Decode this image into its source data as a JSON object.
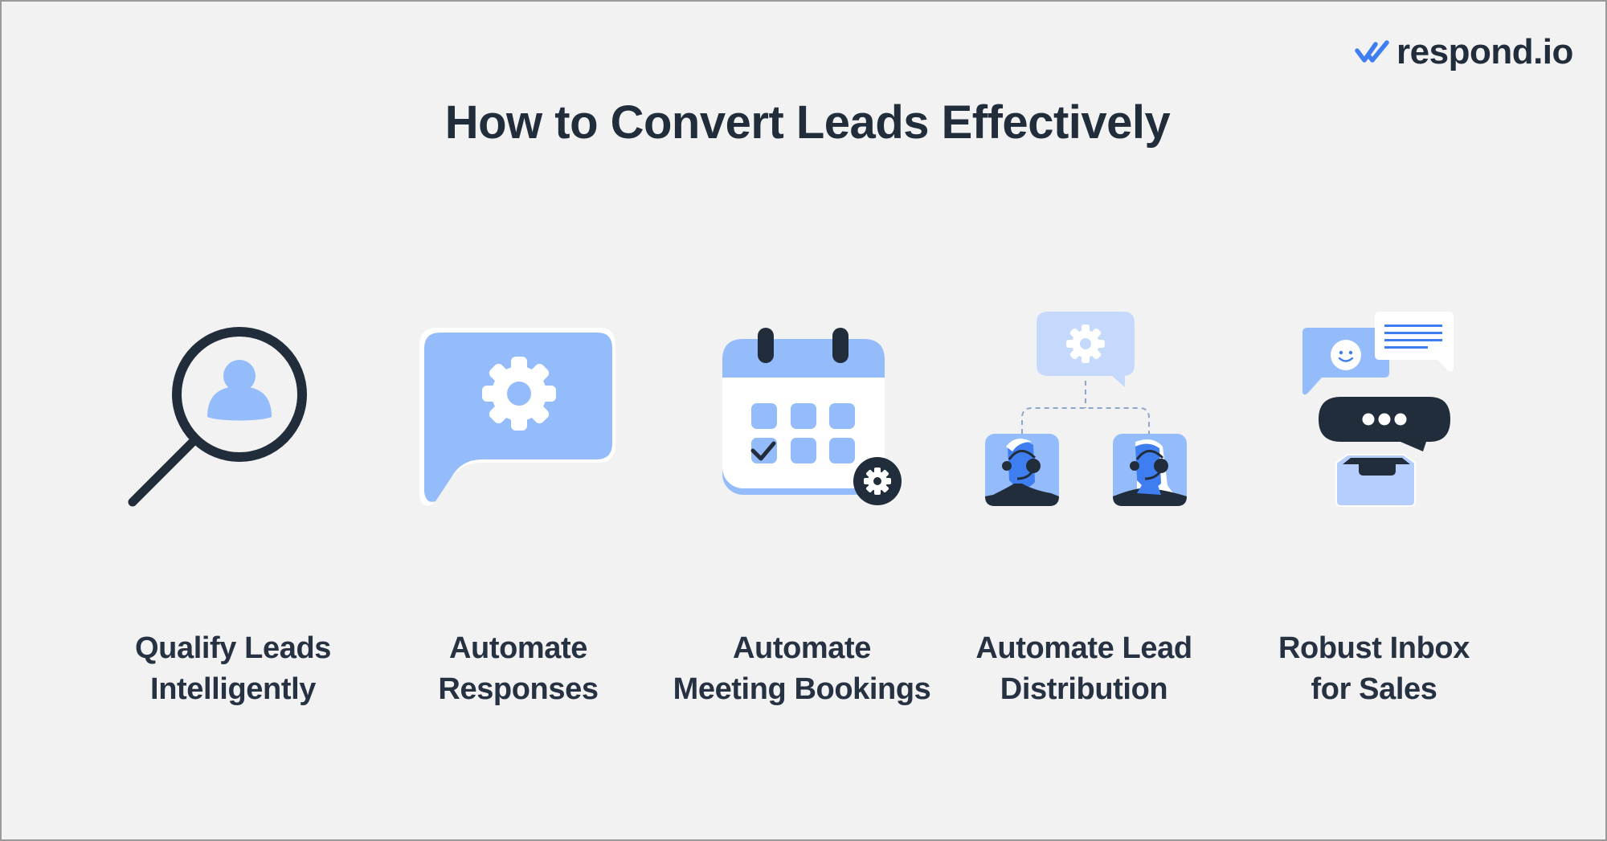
{
  "brand": {
    "logo_icon": "double-check-icon",
    "name": "respond.io"
  },
  "header": {
    "title": "How to Convert Leads Effectively"
  },
  "colors": {
    "background": "#f2f2f2",
    "dark": "#222d3b",
    "light_blue": "#94bbfa",
    "pale_blue": "#c4d9fc",
    "accent_blue": "#3f7ef0"
  },
  "steps": [
    {
      "icon": "magnifier-user-icon",
      "line1": "Qualify Leads",
      "line2": "Intelligently"
    },
    {
      "icon": "chat-bubble-gear-icon",
      "line1": "Automate",
      "line2": "Responses"
    },
    {
      "icon": "calendar-gear-icon",
      "line1": "Automate",
      "line2": "Meeting Bookings"
    },
    {
      "icon": "agent-distribution-icon",
      "line1": "Automate Lead",
      "line2": "Distribution"
    },
    {
      "icon": "inbox-chat-icon",
      "line1": "Robust Inbox",
      "line2": "for Sales"
    }
  ]
}
